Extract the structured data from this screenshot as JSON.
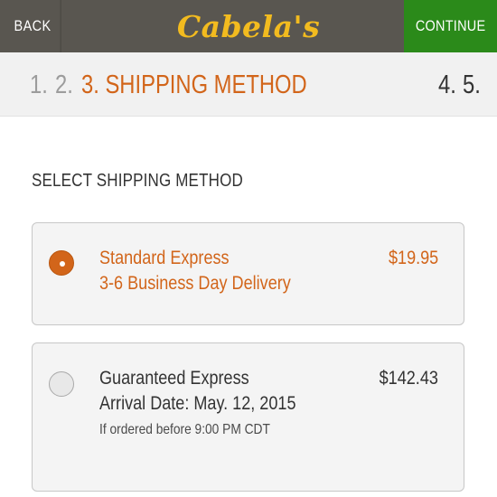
{
  "header": {
    "back_label": "BACK",
    "logo_text": "Cabela's",
    "continue_label": "CONTINUE",
    "colors": {
      "bar": "#595650",
      "continue": "#2b8a1a",
      "logo": "#f2bb1f"
    }
  },
  "steps": {
    "completed": [
      "1.",
      "2."
    ],
    "active": "3. SHIPPING METHOD",
    "upcoming": [
      "4.",
      "5."
    ],
    "active_color": "#d2651a"
  },
  "section_title": "SELECT SHIPPING METHOD",
  "options": [
    {
      "name": "Standard Express",
      "detail": "3-6 Business Day Delivery",
      "price": "$19.95",
      "selected": true
    },
    {
      "name": "Guaranteed Express",
      "detail": "Arrival Date: May. 12, 2015",
      "note": "If ordered before 9:00 PM CDT",
      "price": "$142.43",
      "selected": false
    }
  ]
}
